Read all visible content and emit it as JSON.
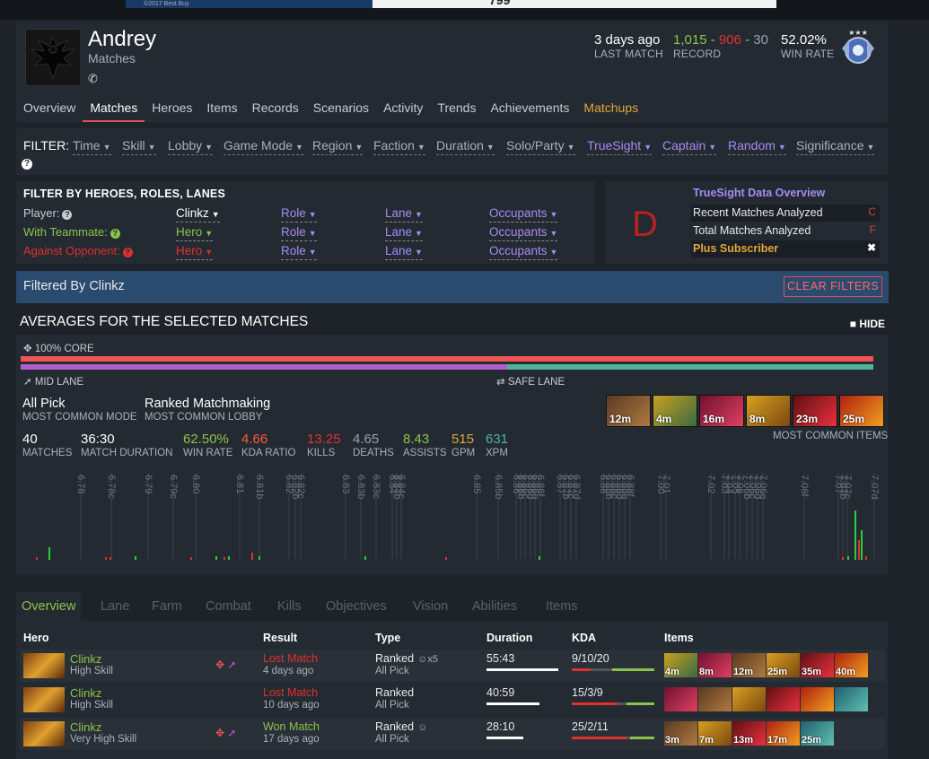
{
  "ad": {
    "left_text": "©2017 Best Buy",
    "right_text": "799"
  },
  "profile": {
    "name": "Andrey",
    "subtitle": "Matches",
    "phone_icon": "phone-icon",
    "last_match_value": "3 days ago",
    "last_match_label": "LAST MATCH",
    "record_wins": "1,015",
    "record_losses": "906",
    "record_abandons": "30",
    "record_label": "RECORD",
    "winrate_value": "52.02%",
    "winrate_label": "WIN RATE"
  },
  "tabs": [
    {
      "label": "Overview"
    },
    {
      "label": "Matches"
    },
    {
      "label": "Heroes"
    },
    {
      "label": "Items"
    },
    {
      "label": "Records"
    },
    {
      "label": "Scenarios"
    },
    {
      "label": "Activity"
    },
    {
      "label": "Trends"
    },
    {
      "label": "Achievements"
    },
    {
      "label": "Matchups"
    }
  ],
  "filter": {
    "label": "FILTER:",
    "items": [
      "Time",
      "Skill",
      "Lobby",
      "Game Mode",
      "Region",
      "Faction",
      "Duration",
      "Solo/Party",
      "TrueSight",
      "Captain",
      "Random",
      "Significance"
    ]
  },
  "heroes_filter": {
    "title": "FILTER BY HEROES, ROLES, LANES",
    "player_label": "Player:",
    "teammate_label": "With Teammate:",
    "opponent_label": "Against Opponent:",
    "player_hero": "Clinkz",
    "teammate_hero": "Hero",
    "opponent_hero": "Hero",
    "role": "Role",
    "lane": "Lane",
    "occupants": "Occupants"
  },
  "truesight": {
    "grade": "D",
    "title": "TrueSight Data Overview",
    "rows": [
      {
        "label": "Recent Matches Analyzed",
        "value": "C"
      },
      {
        "label": "Total Matches Analyzed",
        "value": "F"
      }
    ],
    "plus": "Plus Subscriber",
    "close": "✖"
  },
  "filtered": {
    "title": "Filtered By Clinkz",
    "clear": "CLEAR FILTERS"
  },
  "averages": {
    "title": "AVERAGES FOR THE SELECTED MATCHES",
    "hide": "HIDE",
    "core_label": "100% CORE",
    "core_pct": 100,
    "mid_pct": 57,
    "mid_label": "MID LANE",
    "safe_label": "SAFE LANE",
    "mode_value": "All Pick",
    "mode_label": "MOST COMMON MODE",
    "lobby_value": "Ranked Matchmaking",
    "lobby_label": "MOST COMMON LOBBY",
    "items_label": "MOST COMMON ITEMS",
    "common_items": [
      "12m",
      "4m",
      "16m",
      "8m",
      "23m",
      "25m"
    ],
    "stats": [
      {
        "value": "40",
        "label": "MATCHES",
        "color": "#ffffff"
      },
      {
        "value": "36:30",
        "label": "MATCH DURATION",
        "color": "#ffffff"
      },
      {
        "value": "62.50%",
        "label": "WIN RATE",
        "color": "#8bc34a"
      },
      {
        "value": "4.66",
        "label": "KDA RATIO",
        "color": "#ff5a3c"
      },
      {
        "value": "13.25",
        "label": "KILLS",
        "color": "#e03030"
      },
      {
        "value": "4.65",
        "label": "DEATHS",
        "color": "#9aa0a6"
      },
      {
        "value": "8.43",
        "label": "ASSISTS",
        "color": "#8bc34a"
      },
      {
        "value": "515",
        "label": "GPM",
        "color": "#e2a63c"
      },
      {
        "value": "631",
        "label": "XPM",
        "color": "#4fb39a"
      }
    ],
    "patches": [
      "6.78",
      "6.78c",
      "6.79",
      "6.79c",
      "6.80",
      "6.81",
      "6.81b",
      "6.82",
      "6.82b",
      "6.82c",
      "6.83",
      "6.83b",
      "6.83c",
      "6.84",
      "6.84b",
      "6.84c",
      "6.85",
      "6.85b",
      "6.86",
      "6.86b",
      "6.86c",
      "6.86d",
      "6.86e",
      "6.86f",
      "6.87",
      "6.87b",
      "6.87c",
      "6.87d",
      "6.88",
      "6.88b",
      "6.88c",
      "6.88d",
      "6.88e",
      "6.88f",
      "7.00",
      "7.01",
      "7.02",
      "7.03",
      "7.04",
      "7.05",
      "7.06",
      "7.06b",
      "7.06c",
      "7.06d",
      "7.06e",
      "7.06f",
      "7.07",
      "7.07b",
      "7.07c",
      "7.07d"
    ]
  },
  "lower_tabs": [
    "Overview",
    "Lane",
    "Farm",
    "Combat",
    "Kills",
    "Objectives",
    "Vision",
    "Abilities",
    "Items"
  ],
  "table": {
    "headers": {
      "hero": "Hero",
      "result": "Result",
      "type": "Type",
      "duration": "Duration",
      "kda": "KDA",
      "items": "Items"
    },
    "rows": [
      {
        "hero": "Clinkz",
        "skill": "High Skill",
        "result": "Lost Match",
        "result_color": "#e03030",
        "ago": "4 days ago",
        "type": "Ranked",
        "party": "x5",
        "mode": "All Pick",
        "duration": "55:43",
        "dur_pct": 100,
        "kda": "9/10/20",
        "k": 9,
        "d": 10,
        "a": 20,
        "items": [
          "4m",
          "8m",
          "12m",
          "25m",
          "35m",
          "40m"
        ],
        "roles": true
      },
      {
        "hero": "Clinkz",
        "skill": "High Skill",
        "result": "Lost Match",
        "result_color": "#e03030",
        "ago": "10 days ago",
        "type": "Ranked",
        "party": "",
        "mode": "All Pick",
        "duration": "40:59",
        "dur_pct": 74,
        "kda": "15/3/9",
        "k": 15,
        "d": 3,
        "a": 9,
        "items": [
          "",
          "",
          "",
          "",
          "",
          ""
        ],
        "roles": false
      },
      {
        "hero": "Clinkz",
        "skill": "Very High Skill",
        "result": "Won Match",
        "result_color": "#8bc34a",
        "ago": "17 days ago",
        "type": "Ranked",
        "party": "solo",
        "mode": "All Pick",
        "duration": "28:10",
        "dur_pct": 51,
        "kda": "25/2/11",
        "k": 25,
        "d": 2,
        "a": 11,
        "items": [
          "3m",
          "7m",
          "13m",
          "17m",
          "25m",
          ""
        ],
        "roles": true
      }
    ]
  },
  "colors": {
    "accent_red": "#d9534f",
    "win_green": "#8bc34a",
    "truesight_purple": "#a58cf2",
    "gold": "#e2a63c"
  }
}
